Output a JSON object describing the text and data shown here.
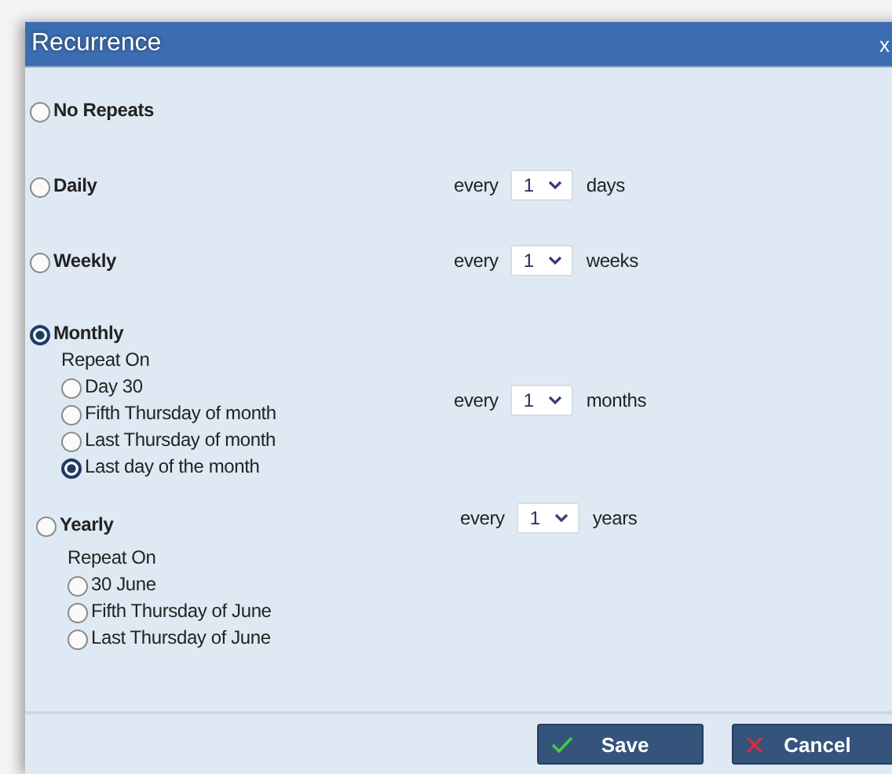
{
  "dialog": {
    "title": "Recurrence",
    "close": "x"
  },
  "options": [
    {
      "label": "No Repeats",
      "selected": false
    },
    {
      "label": "Daily",
      "selected": false,
      "every": {
        "prefix": "every",
        "value": "1",
        "unit": "days"
      }
    },
    {
      "label": "Weekly",
      "selected": false,
      "every": {
        "prefix": "every",
        "value": "1",
        "unit": "weeks"
      }
    },
    {
      "label": "Monthly",
      "selected": true,
      "every": {
        "prefix": "every",
        "value": "1",
        "unit": "months"
      },
      "repeat_on": {
        "label": "Repeat On",
        "choices": [
          {
            "label": "Day 30",
            "selected": false
          },
          {
            "label": "Fifth Thursday of month",
            "selected": false
          },
          {
            "label": "Last Thursday of month",
            "selected": false
          },
          {
            "label": "Last day of the month",
            "selected": true
          }
        ]
      }
    },
    {
      "label": "Yearly",
      "selected": false,
      "every": {
        "prefix": "every",
        "value": "1",
        "unit": "years"
      },
      "repeat_on": {
        "label": "Repeat On",
        "choices": [
          {
            "label": "30 June",
            "selected": false
          },
          {
            "label": "Fifth Thursday of June",
            "selected": false
          },
          {
            "label": "Last Thursday of June",
            "selected": false
          }
        ]
      }
    }
  ],
  "buttons": [
    {
      "label": "Save",
      "kind": "save"
    },
    {
      "label": "Cancel",
      "kind": "cancel"
    }
  ]
}
